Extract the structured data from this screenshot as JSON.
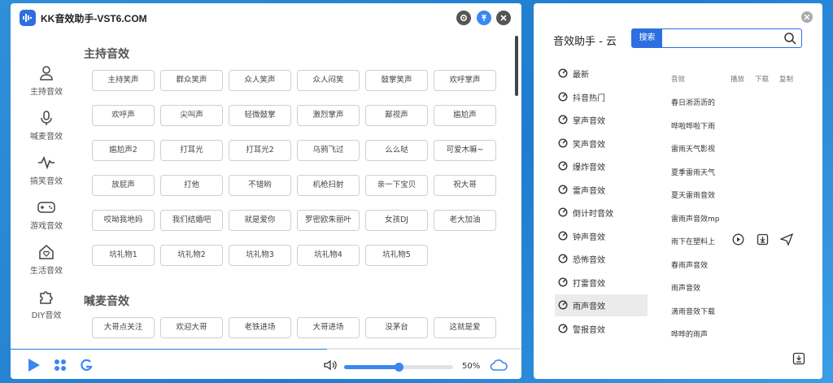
{
  "left_window": {
    "title": "KK音效助手-VST6.COM",
    "titlebar_buttons": [
      {
        "name": "settings",
        "icon": "gear-icon"
      },
      {
        "name": "pin-top",
        "icon": "arrow-up-icon"
      },
      {
        "name": "close",
        "icon": "close-icon"
      }
    ],
    "sidebar": {
      "items": [
        {
          "label": "主持音效",
          "icon": "person-icon"
        },
        {
          "label": "喊麦音效",
          "icon": "microphone-icon"
        },
        {
          "label": "搞笑音效",
          "icon": "waveform-icon"
        },
        {
          "label": "游戏音效",
          "icon": "gamepad-icon"
        },
        {
          "label": "生活音效",
          "icon": "home-heart-icon"
        },
        {
          "label": "DIY音效",
          "icon": "puzzle-icon"
        }
      ]
    },
    "sections": [
      {
        "title": "主持音效",
        "buttons": [
          "主持笑声",
          "群众笑声",
          "众人笑声",
          "众人闷笑",
          "鼓掌笑声",
          "欢呼掌声",
          "欢呼声",
          "尖叫声",
          "轻微鼓掌",
          "激烈掌声",
          "鄙视声",
          "尴尬声",
          "尴尬声2",
          "打耳光",
          "打耳光2",
          "乌鸦飞过",
          "么么哒",
          "可爱木嘛~",
          "放屁声",
          "打他",
          "不错哟",
          "机枪扫射",
          "亲一下宝贝",
          "祝大哥",
          "哎呦我地妈",
          "我们结婚吧",
          "就是爱你",
          "罗密欧朱丽叶",
          "女孩DJ",
          "老大加油",
          "坑礼物1",
          "坑礼物2",
          "坑礼物3",
          "坑礼物4",
          "坑礼物5"
        ]
      },
      {
        "title": "喊麦音效",
        "buttons": [
          "大哥点关注",
          "欢迎大哥",
          "老铁进场",
          "大哥进场",
          "没茅台",
          "这就是爱"
        ]
      }
    ],
    "player": {
      "playback_progress": 0.62,
      "volume": 0.5,
      "volume_text": "50%",
      "controls": [
        "play-icon",
        "apps-grid-icon",
        "swirl-logo-icon",
        "speaker-icon",
        "cloud-icon"
      ]
    }
  },
  "right_window": {
    "title": "音效助手 - 云",
    "search": {
      "button_label": "搜索",
      "value": "",
      "placeholder": ""
    },
    "categories": [
      {
        "label": "最新",
        "active": false
      },
      {
        "label": "抖音热门",
        "active": false
      },
      {
        "label": "掌声音效",
        "active": false
      },
      {
        "label": "笑声音效",
        "active": false
      },
      {
        "label": "爆炸音效",
        "active": false
      },
      {
        "label": "雷声音效",
        "active": false
      },
      {
        "label": "倒计时音效",
        "active": false
      },
      {
        "label": "钟声音效",
        "active": false
      },
      {
        "label": "恐怖音效",
        "active": false
      },
      {
        "label": "打雷音效",
        "active": false
      },
      {
        "label": "雨声音效",
        "active": true
      },
      {
        "label": "警报音效",
        "active": false
      }
    ],
    "list_headers": {
      "name": "音效",
      "play": "播放",
      "download": "下载",
      "copy": "复制"
    },
    "sounds": [
      "春日淅沥沥的",
      "哗啦哗啦下雨",
      "雷雨天气影视",
      "夏季雷雨天气",
      "夏天雷雨音效",
      "雷雨声音效mp",
      "雨下在塑料上",
      "春雨声音效",
      "雨声音效",
      "滴雨音效下载",
      "哗哗的雨声"
    ],
    "hover_row_index": 6
  }
}
